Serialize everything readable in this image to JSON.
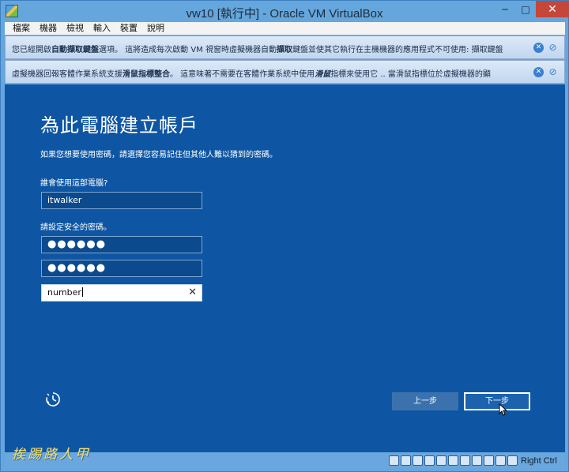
{
  "window": {
    "title": "vw10 [執行中] - Oracle VM VirtualBox"
  },
  "window_controls": {
    "minimize": "─",
    "maximize": "□",
    "close": "✕"
  },
  "menu": {
    "items": [
      "檔案",
      "機器",
      "檢視",
      "輸入",
      "裝置",
      "說明"
    ]
  },
  "notices": [
    {
      "pre": "您已經開啟",
      "bold1": "自動擷取鍵盤",
      "mid": "選項。 這將造成每次啟動 VM 視窗時虛擬機器自動",
      "bold2": "擷取",
      "post": "鍵盤並使其它執行在主機機器的應用程式不可使用: 擷取鍵盤"
    },
    {
      "pre": "虛擬機器回報客體作業系統支援",
      "bold1": "滑鼠指標整合",
      "mid": "。 這意味著不需要在客體作業系統中使用",
      "bold2": "滑鼠",
      "post": "指標來使用它 .. 當滑鼠指標位於虛擬機器的顯"
    }
  ],
  "setup": {
    "heading": "為此電腦建立帳戶",
    "description": "如果您想要使用密碼，請選擇您容易記住但其他人難以猜到的密碼。",
    "user_label": "誰會使用這部電腦?",
    "user_value": "itwalker",
    "password_label": "請設定安全的密碼。",
    "password_mask": "●●●●●●",
    "confirm_mask": "●●●●●●",
    "hint_value": "number",
    "back_button": "上一步",
    "next_button": "下一步"
  },
  "statusbar": {
    "host_key": "Right Ctrl",
    "watermark": "挨踢路人甲"
  },
  "colors": {
    "guest_bg": "#0e56a3",
    "close_btn": "#c7463a",
    "frame": "#65a6dd"
  }
}
